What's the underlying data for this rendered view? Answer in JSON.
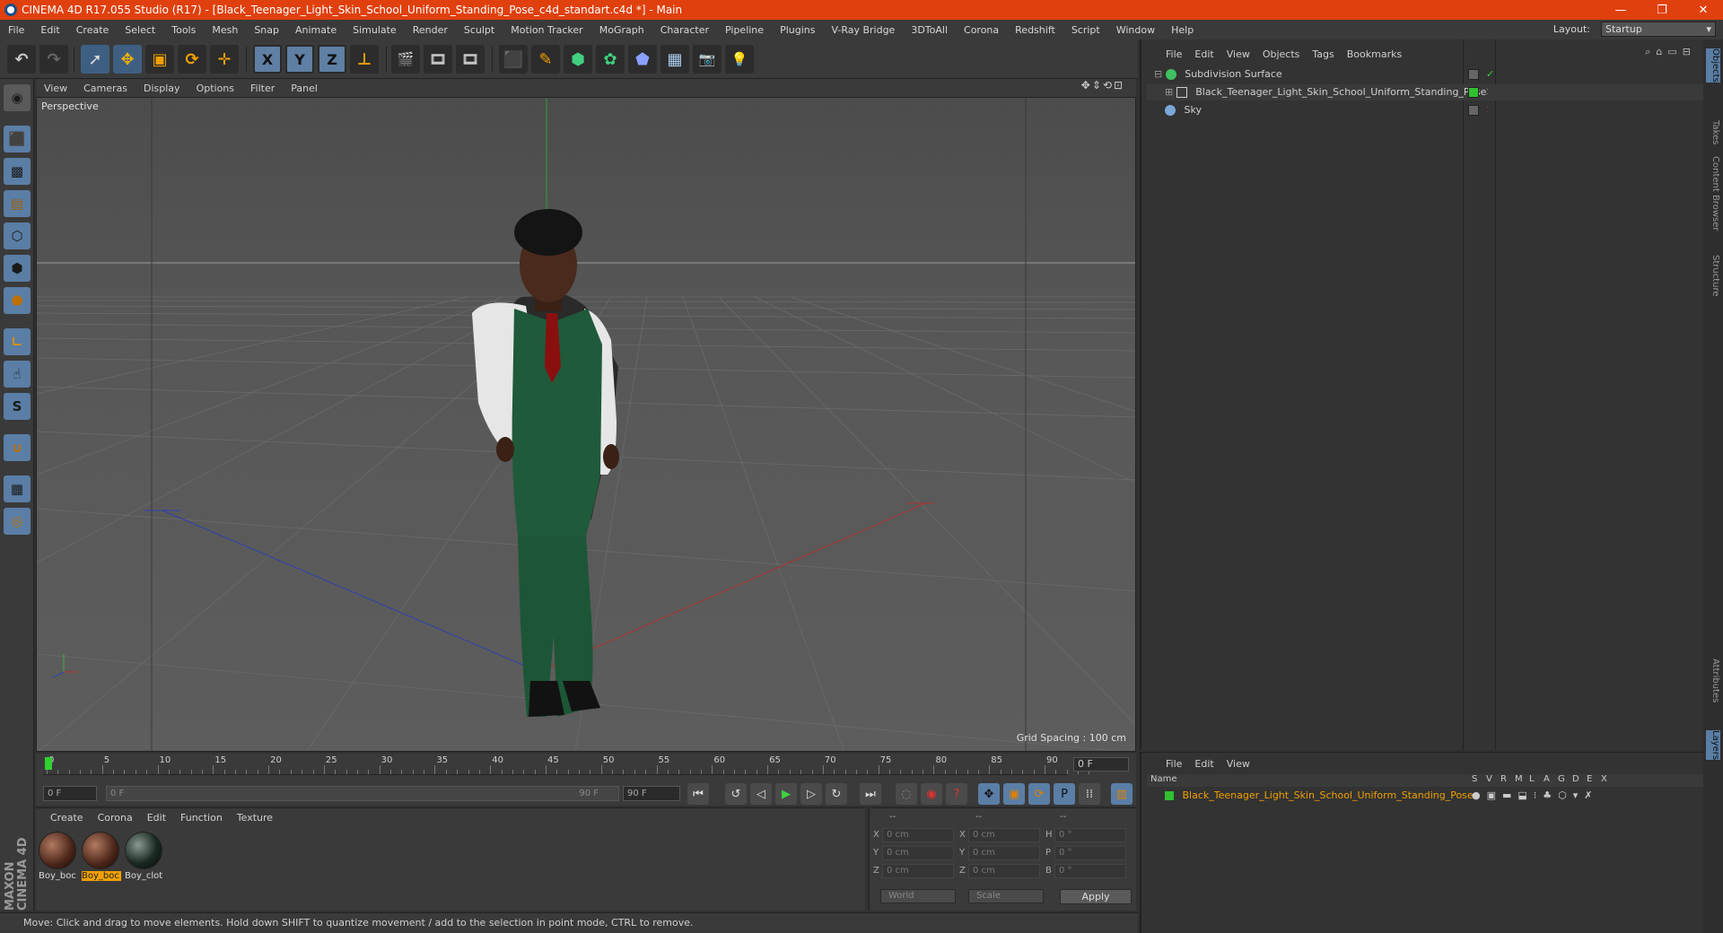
{
  "titlebar": {
    "title": "CINEMA 4D R17.055 Studio (R17) - [Black_Teenager_Light_Skin_School_Uniform_Standing_Pose_c4d_standart.c4d *] - Main",
    "minimize": "—",
    "restore": "❐",
    "close": "✕"
  },
  "menubar": {
    "items": [
      "File",
      "Edit",
      "Create",
      "Select",
      "Tools",
      "Mesh",
      "Snap",
      "Animate",
      "Simulate",
      "Render",
      "Sculpt",
      "Motion Tracker",
      "MoGraph",
      "Character",
      "Pipeline",
      "Plugins",
      "V-Ray Bridge",
      "3DToAll",
      "Corona",
      "Redshift",
      "Script",
      "Window",
      "Help"
    ]
  },
  "layout": {
    "label": "Layout:",
    "value": "Startup"
  },
  "toolbar": {
    "undo": "↶",
    "redo": "↷",
    "select": "➚",
    "move": "✥",
    "scale": "▣",
    "rotate": "⟳",
    "last": "✛",
    "x": "X",
    "y": "Y",
    "z": "Z",
    "coord": "⊥",
    "render1": "🎬",
    "render2": "🎞",
    "render3": "🎞",
    "cube": "⬛",
    "pen": "✎",
    "nurbs": "⬢",
    "array": "✿",
    "deformer": "⬟",
    "floor": "▦",
    "camera": "📷",
    "light": "💡"
  },
  "left_tools": {
    "icons": [
      "model-mode-icon",
      "object-mode-icon",
      "texture-mode-icon",
      "workplane-icon",
      "points-mode-icon",
      "edges-mode-icon",
      "polygons-mode-icon",
      "axis-mode-icon",
      "tweak-mode-icon",
      "snap-icon",
      "magnet-icon",
      "grid-lock-icon",
      "solo-icon"
    ]
  },
  "maxon": {
    "text": "MAXON CINEMA 4D"
  },
  "viewport": {
    "menu": [
      "View",
      "Cameras",
      "Display",
      "Options",
      "Filter",
      "Panel"
    ],
    "name": "Perspective",
    "grid_spacing": "Grid Spacing : 100 cm",
    "nav_icons": "✥⇕⟲⊡"
  },
  "timeline": {
    "ticks": [
      "0",
      "5",
      "10",
      "15",
      "20",
      "25",
      "30",
      "35",
      "40",
      "45",
      "50",
      "55",
      "60",
      "65",
      "70",
      "75",
      "80",
      "85",
      "90"
    ],
    "current_frame": "0 F"
  },
  "transport": {
    "start": "0 F",
    "range_start": "0 F",
    "range_end": "90 F",
    "end": "90 F"
  },
  "materials": {
    "menu": [
      "Create",
      "Corona",
      "Edit",
      "Function",
      "Texture"
    ],
    "items": [
      {
        "label": "Boy_boc"
      },
      {
        "label": "Boy_boc"
      },
      {
        "label": "Boy_clot"
      }
    ]
  },
  "coords": {
    "header": [
      "--",
      "--",
      "--"
    ],
    "rows": [
      {
        "a": "X",
        "av": "0 cm",
        "b": "X",
        "bv": "0 cm",
        "c": "H",
        "cv": "0 °"
      },
      {
        "a": "Y",
        "av": "0 cm",
        "b": "Y",
        "bv": "0 cm",
        "c": "P",
        "cv": "0 °"
      },
      {
        "a": "Z",
        "av": "0 cm",
        "b": "Z",
        "bv": "0 cm",
        "c": "B",
        "cv": "0 °"
      }
    ],
    "world": "World",
    "scale": "Scale",
    "apply": "Apply"
  },
  "status": {
    "text": "Move: Click and drag to move elements. Hold down SHIFT to quantize movement / add to the selection in point mode, CTRL to remove."
  },
  "objects": {
    "menu": [
      "File",
      "Edit",
      "View",
      "Objects",
      "Tags",
      "Bookmarks"
    ],
    "rows": [
      {
        "name": "Subdivision Surface"
      },
      {
        "name": "Black_Teenager_Light_Skin_School_Uniform_Standing_Pose"
      },
      {
        "name": "Sky"
      }
    ]
  },
  "layers": {
    "menu": [
      "File",
      "Edit",
      "View"
    ],
    "name_header": "Name",
    "cols": [
      "S",
      "V",
      "R",
      "M",
      "L",
      "A",
      "G",
      "D",
      "E",
      "X"
    ],
    "row": "Black_Teenager_Light_Skin_School_Uniform_Standing_Pose"
  },
  "right_tabs": [
    "Objects",
    "Takes",
    "Content Browser",
    "Structure",
    "Attributes",
    "Layers"
  ]
}
